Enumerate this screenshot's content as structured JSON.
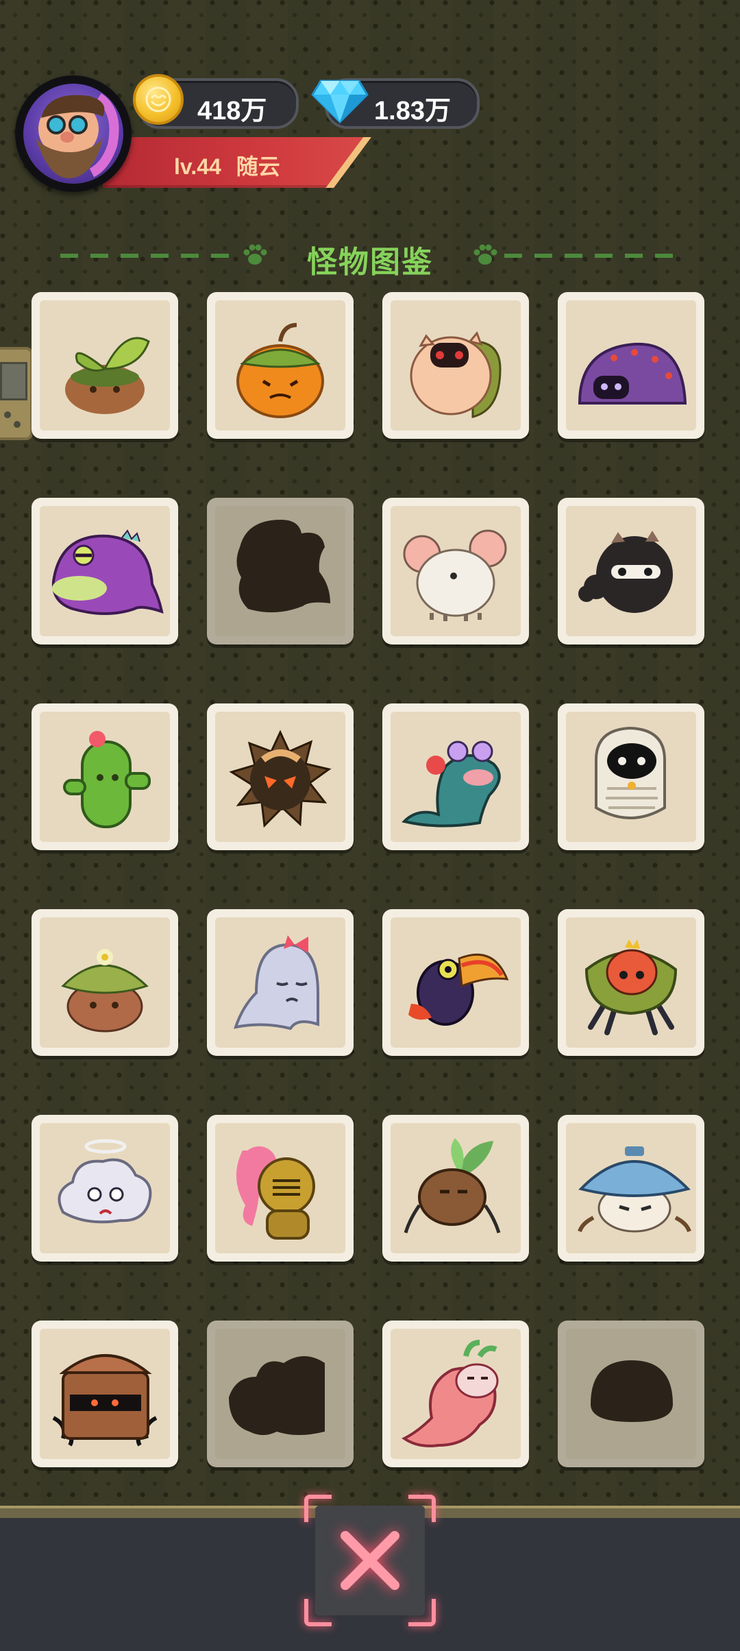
{
  "header": {
    "player_level": "lv.44",
    "player_name": "随云",
    "coins": "418万",
    "gems": "1.83万",
    "avatar_icon": "bearded-hero-avatar",
    "coin_icon": "smiley-coin-icon",
    "gem_icon": "blue-diamond-icon"
  },
  "page": {
    "title": "怪物图鉴",
    "title_color": "#86d35b",
    "decor_icon": "paw-icon"
  },
  "monsters": [
    {
      "name": "sprout-dirt-monster",
      "unlocked": true
    },
    {
      "name": "pumpkin-monster",
      "unlocked": true
    },
    {
      "name": "pig-snail-monster",
      "unlocked": true
    },
    {
      "name": "purple-berry-blob-monster",
      "unlocked": true
    },
    {
      "name": "purple-dino-monster",
      "unlocked": true
    },
    {
      "name": "unknown-silhouette-1",
      "unlocked": false
    },
    {
      "name": "white-mouse-monster",
      "unlocked": true
    },
    {
      "name": "black-fluff-monster",
      "unlocked": true
    },
    {
      "name": "cactus-monster",
      "unlocked": true
    },
    {
      "name": "spiky-chestnut-monster",
      "unlocked": true
    },
    {
      "name": "teal-slug-monster",
      "unlocked": true
    },
    {
      "name": "mummy-monster",
      "unlocked": true
    },
    {
      "name": "flower-dirt-monster",
      "unlocked": true
    },
    {
      "name": "ghost-with-bow-monster",
      "unlocked": true
    },
    {
      "name": "toucan-monster",
      "unlocked": true
    },
    {
      "name": "flower-spider-monster",
      "unlocked": true
    },
    {
      "name": "angel-cloud-monster",
      "unlocked": true
    },
    {
      "name": "knight-monster",
      "unlocked": true
    },
    {
      "name": "pot-plant-monster",
      "unlocked": true
    },
    {
      "name": "mushroom-hat-monster",
      "unlocked": true
    },
    {
      "name": "treasure-chest-monster",
      "unlocked": true
    },
    {
      "name": "unknown-silhouette-2",
      "unlocked": false
    },
    {
      "name": "radish-dragon-monster",
      "unlocked": true
    },
    {
      "name": "unknown-silhouette-3",
      "unlocked": false
    }
  ],
  "footer": {
    "close_icon": "close-icon",
    "accent_color": "#ff8f9e"
  }
}
